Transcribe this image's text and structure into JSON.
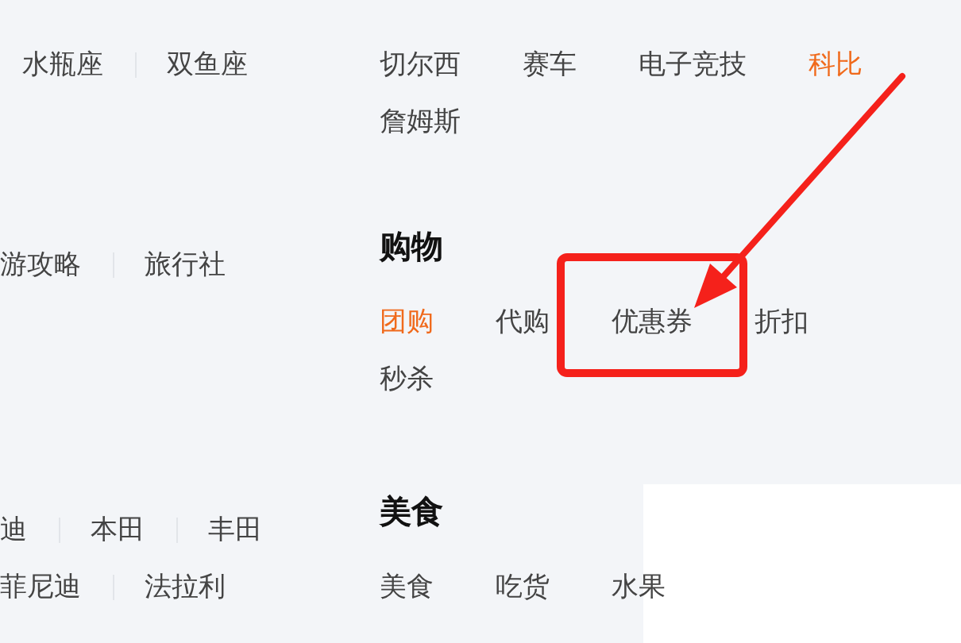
{
  "sections": [
    {
      "left": {
        "rows": [
          [
            {
              "label": "水瓶座",
              "highlighted": false
            },
            {
              "label": "双鱼座",
              "highlighted": false
            }
          ]
        ]
      },
      "main": {
        "rows": [
          [
            {
              "label": "切尔西",
              "highlighted": false
            },
            {
              "label": "赛车",
              "highlighted": false
            },
            {
              "label": "电子竞技",
              "highlighted": false
            },
            {
              "label": "科比",
              "highlighted": true
            }
          ],
          [
            {
              "label": "詹姆斯",
              "highlighted": false
            }
          ]
        ]
      }
    },
    {
      "left": {
        "rows": [
          [
            {
              "label": "游攻略",
              "highlighted": false
            },
            {
              "label": "旅行社",
              "highlighted": false
            }
          ]
        ]
      },
      "main": {
        "heading": "购物",
        "rows": [
          [
            {
              "label": "团购",
              "highlighted": true
            },
            {
              "label": "代购",
              "highlighted": false
            },
            {
              "label": "优惠券",
              "highlighted": false
            },
            {
              "label": "折扣",
              "highlighted": false
            }
          ],
          [
            {
              "label": "秒杀",
              "highlighted": false
            }
          ]
        ]
      }
    },
    {
      "left": {
        "rows": [
          [
            {
              "label": "迪",
              "highlighted": false
            },
            {
              "label": "本田",
              "highlighted": false
            },
            {
              "label": "丰田",
              "highlighted": false
            }
          ],
          [
            {
              "label": "菲尼迪",
              "highlighted": false
            },
            {
              "label": "法拉利",
              "highlighted": false
            }
          ]
        ]
      },
      "main": {
        "heading": "美食",
        "rows": [
          [
            {
              "label": "美食",
              "highlighted": false
            },
            {
              "label": "吃货",
              "highlighted": false
            },
            {
              "label": "水果",
              "highlighted": false
            }
          ]
        ]
      }
    }
  ]
}
